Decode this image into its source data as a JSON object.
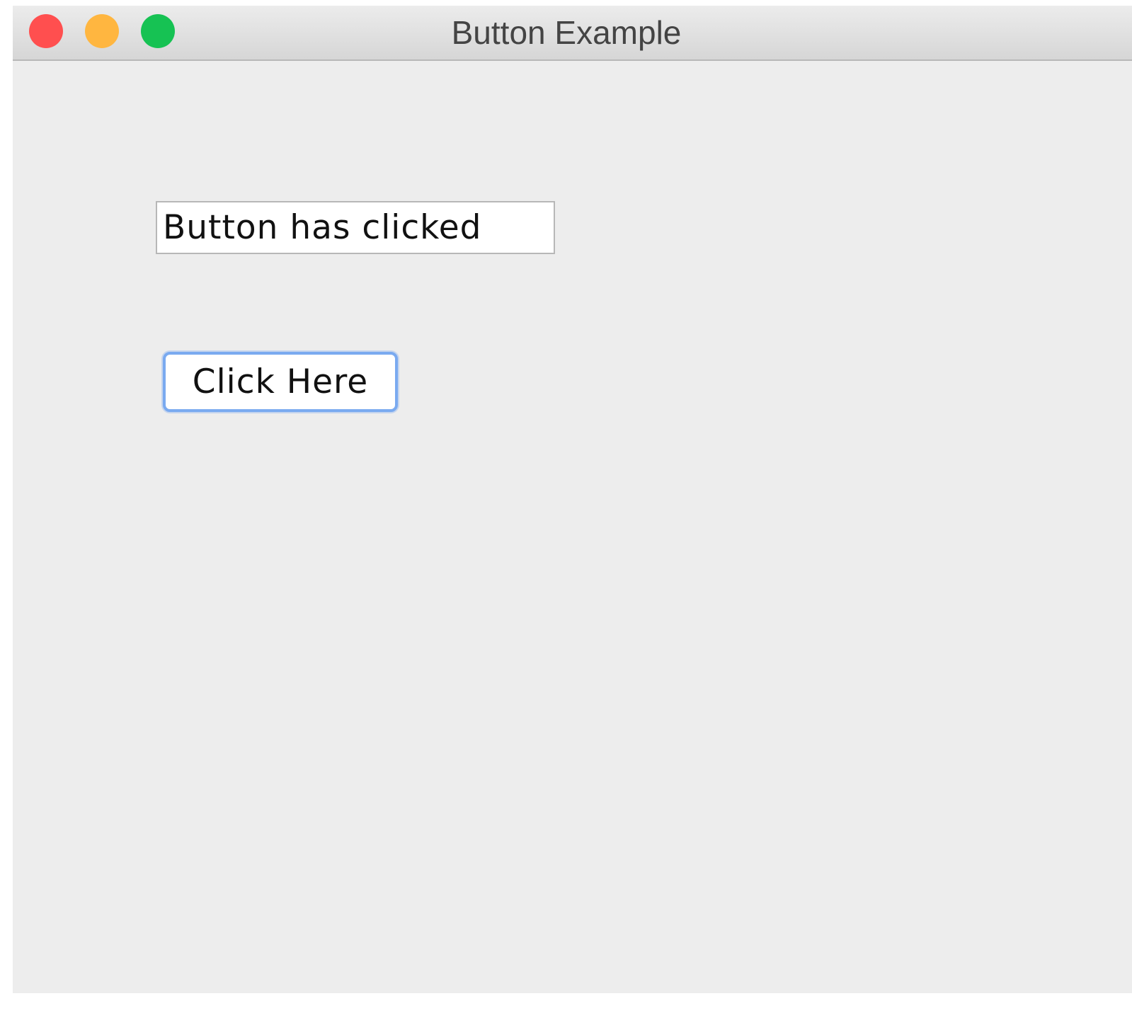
{
  "window": {
    "title": "Button Example",
    "controls": {
      "close_color": "#ff4f4f",
      "minimize_color": "#ffb640",
      "maximize_color": "#16c253"
    }
  },
  "content": {
    "text_field_value": "Button has clicked",
    "button_label": "Click Here"
  }
}
